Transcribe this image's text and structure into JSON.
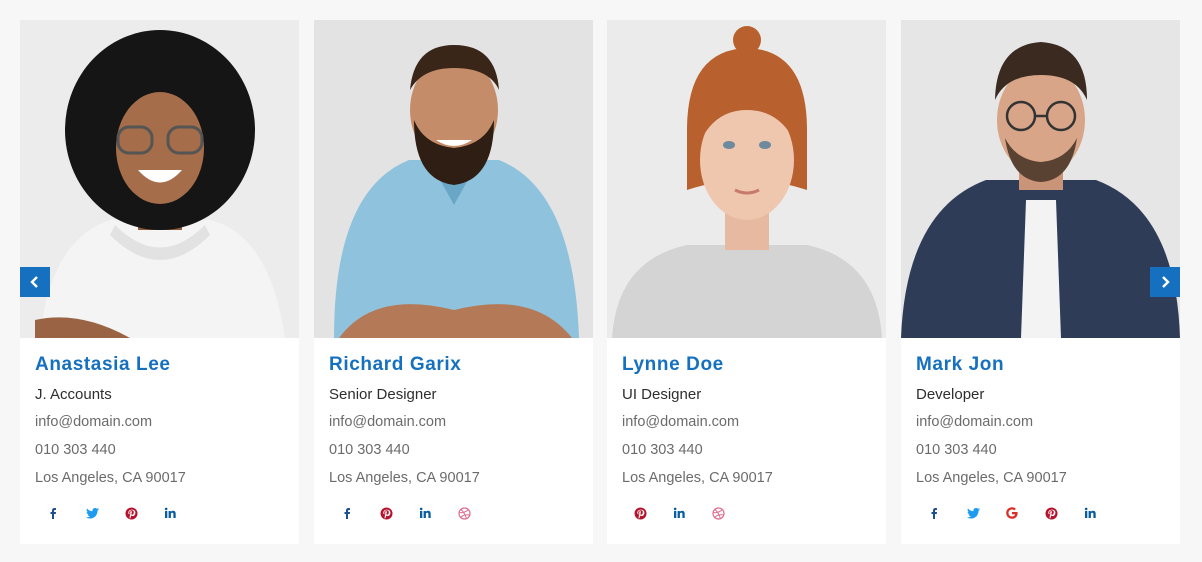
{
  "colors": {
    "accent": "#1670c0",
    "page_background": "#f7f7f7",
    "card_background": "#ffffff",
    "facebook": "#1b4f8f",
    "twitter": "#1d9bf0",
    "pinterest": "#b5122b",
    "linkedin": "#0a5d9e",
    "google": "#d93025",
    "dribbble": "#e06c8e"
  },
  "carousel": {
    "prev_icon": "chevron-left-icon",
    "next_icon": "chevron-right-icon"
  },
  "team": [
    {
      "name": "Anastasia Lee",
      "role": "J. Accounts",
      "email": "info@domain.com",
      "phone": "010 303 440",
      "address": "Los Angeles, CA 90017",
      "social": [
        "facebook-icon",
        "twitter-icon",
        "pinterest-icon",
        "linkedin-icon"
      ]
    },
    {
      "name": "Richard Garix",
      "role": "Senior Designer",
      "email": "info@domain.com",
      "phone": "010 303 440",
      "address": "Los Angeles, CA 90017",
      "social": [
        "facebook-icon",
        "pinterest-icon",
        "linkedin-icon",
        "dribbble-icon"
      ]
    },
    {
      "name": "Lynne Doe",
      "role": "UI Designer",
      "email": "info@domain.com",
      "phone": "010 303 440",
      "address": "Los Angeles, CA 90017",
      "social": [
        "pinterest-icon",
        "linkedin-icon",
        "dribbble-icon"
      ]
    },
    {
      "name": "Mark Jon",
      "role": "Developer",
      "email": "info@domain.com",
      "phone": "010 303 440",
      "address": "Los Angeles, CA 90017",
      "social": [
        "facebook-icon",
        "twitter-icon",
        "google-icon",
        "pinterest-icon",
        "linkedin-icon"
      ]
    }
  ]
}
